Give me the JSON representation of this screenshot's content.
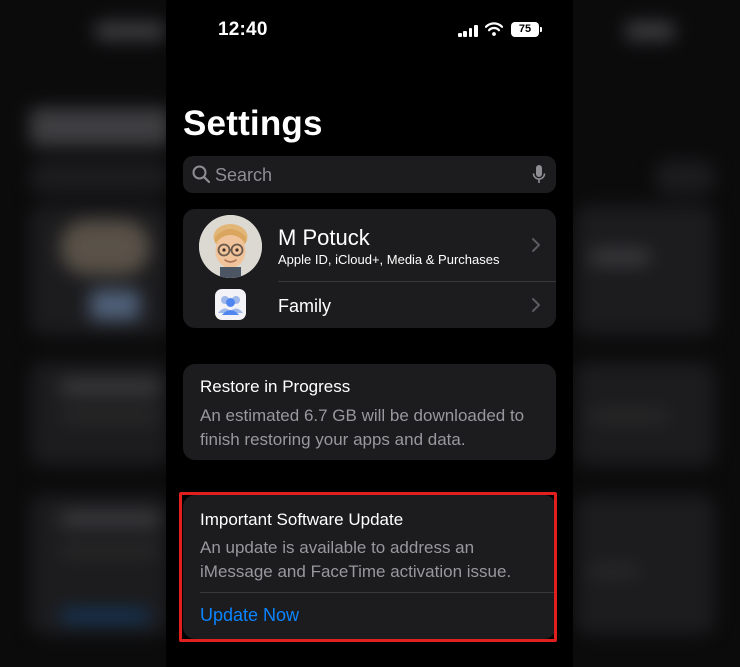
{
  "status_bar": {
    "time": "12:40",
    "battery": "75"
  },
  "page": {
    "title": "Settings"
  },
  "search": {
    "placeholder": "Search"
  },
  "account": {
    "name": "M Potuck",
    "subtitle": "Apple ID, iCloud+, Media & Purchases",
    "family_label": "Family"
  },
  "restore": {
    "title": "Restore in Progress",
    "body": "An estimated 6.7 GB will be downloaded to finish restoring your apps and data."
  },
  "update": {
    "title": "Important Software Update",
    "body": "An update is available to address an iMessage and FaceTime activation issue.",
    "action": "Update Now"
  },
  "colors": {
    "accent": "#0a84ff",
    "highlight": "#e0201f",
    "card": "#1c1c1e",
    "secondary_text": "#98989d"
  }
}
